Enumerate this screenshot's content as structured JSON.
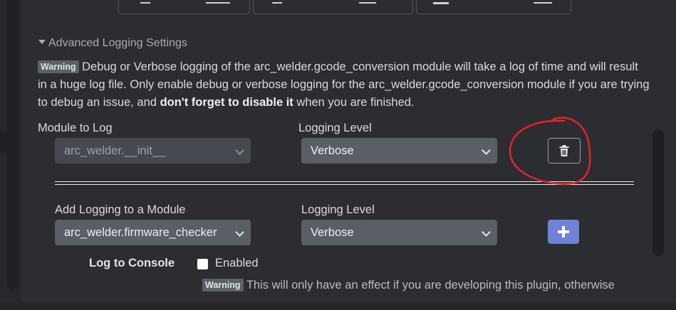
{
  "advanced": {
    "title": "Advanced Logging Settings",
    "warning_badge": "Warning",
    "warning_text_1": " Debug or Verbose logging of the arc_welder.gcode_conversion module will take a log of time and will result in a huge log file. Only enable debug or verbose logging for the arc_welder.gcode_conversion module if you are trying to debug an issue, and ",
    "warning_bold": "don't forget to disable it",
    "warning_text_2": " when you are finished."
  },
  "existing_logger": {
    "module_label": "Module to Log",
    "module_value": "arc_welder.__init__",
    "level_label": "Logging Level",
    "level_value": "Verbose"
  },
  "add_logger": {
    "module_label": "Add Logging to a Module",
    "module_value": "arc_welder.firmware_checker",
    "level_label": "Logging Level",
    "level_value": "Verbose"
  },
  "console": {
    "label": "Log to Console",
    "checkbox_label": "Enabled",
    "checked": false,
    "note_badge": "Warning",
    "note_text": " This will only have an effect if you are developing this plugin, otherwise"
  },
  "icons": {
    "section_toggle": "caret-down-icon",
    "remove": "trash-icon",
    "add": "plus-icon"
  },
  "colors": {
    "background": "#2b2d31",
    "select_background": "#5a5f66",
    "add_button": "#6f82d6",
    "annotation": "#e0242b"
  }
}
